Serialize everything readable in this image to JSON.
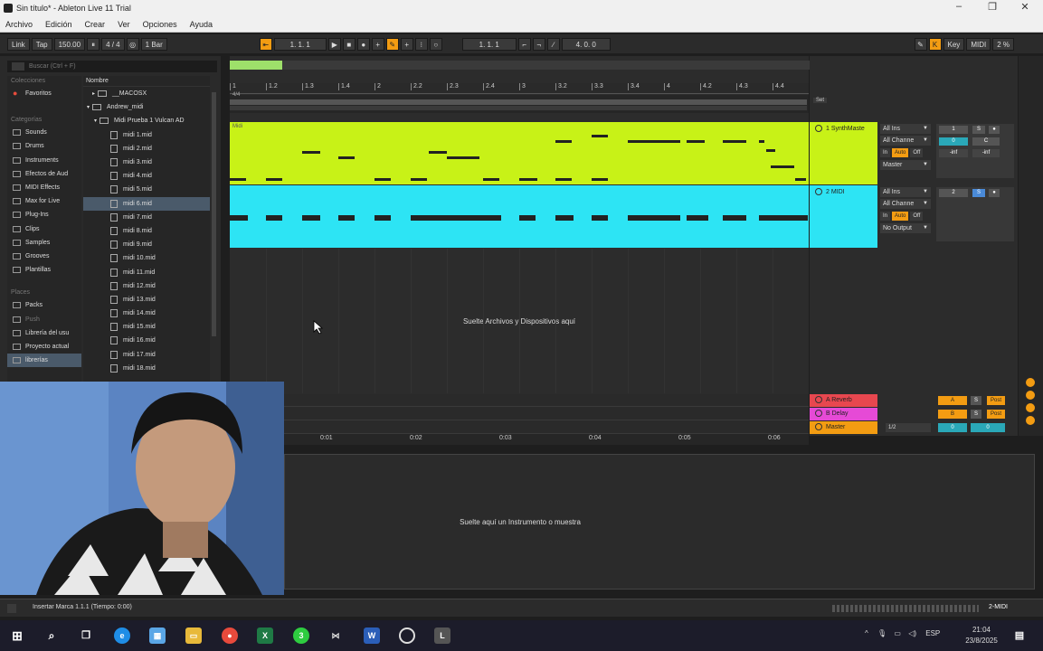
{
  "window": {
    "title": "Sin título* - Ableton Live 11 Trial",
    "minimize": "–",
    "maximize": "❐",
    "close": "✕"
  },
  "menu": [
    "Archivo",
    "Edición",
    "Crear",
    "Ver",
    "Opciones",
    "Ayuda"
  ],
  "control_bar": {
    "link": "Link",
    "tap": "Tap",
    "tempo": "150.00",
    "signature": "4 / 4",
    "quantize": "1 Bar",
    "position": "1.  1.  1",
    "loop_start": "1.  1.  1",
    "loop_length": "4.  0.  0",
    "key": "Key",
    "midi": "MIDI",
    "cpu": "2 %"
  },
  "browser": {
    "search_placeholder": "Buscar (Ctrl + F)",
    "collections_header": "Colecciones",
    "favorites": "Favoritos",
    "categories_header": "Categorías",
    "categories": [
      "Sounds",
      "Drums",
      "Instruments",
      "Efectos de Aud",
      "MIDI Effects",
      "Max for Live",
      "Plug-Ins",
      "Clips",
      "Samples",
      "Grooves",
      "Plantillas"
    ],
    "places_header": "Places",
    "places": [
      "Packs",
      "Push",
      "Librería del usu",
      "Proyecto actual",
      "librerías"
    ],
    "name_header": "Nombre",
    "folders": [
      "__MACOSX",
      "Andrew_midi",
      "Midi Prueba 1 Vulcan AD"
    ],
    "files": [
      "midi 1.mid",
      "midi 2.mid",
      "midi 3.mid",
      "midi 4.mid",
      "midi 5.mid",
      "midi 6.mid",
      "midi 7.mid",
      "midi 8.mid",
      "midi 9.mid",
      "midi 10.mid",
      "midi 11.mid",
      "midi 12.mid",
      "midi 13.mid",
      "midi 14.mid",
      "midi 15.mid",
      "midi 16.mid",
      "midi 17.mid",
      "midi 18.mid"
    ],
    "selected_file": "midi 6.mid"
  },
  "arrangement": {
    "time_signature": "4/4",
    "ruler": [
      "1",
      "1.2",
      "1.3",
      "1.4",
      "2",
      "2.2",
      "2.3",
      "2.4",
      "3",
      "3.2",
      "3.3",
      "3.4",
      "4",
      "4.2",
      "4.3",
      "4.4"
    ],
    "drop_files_text": "Suelte Archivos y Dispositivos aquí",
    "clip1_name": "Midi",
    "set_label": "Set",
    "time_ruler": [
      "0:01",
      "0:02",
      "0:03",
      "0:04",
      "0:05",
      "0:06"
    ]
  },
  "tracks": [
    {
      "name": "1 SynthMaste",
      "color": "#c8f217",
      "input": "All Ins",
      "channel": "All Channe",
      "monitor": [
        "In",
        "Auto",
        "Off"
      ],
      "output": "Master",
      "volume": "-inf",
      "pan": "-inf",
      "number": "1",
      "solo": "S",
      "center": "C",
      "zero": "0"
    },
    {
      "name": "2 MIDI",
      "color": "#2de4f4",
      "input": "All Ins",
      "channel": "All Channe",
      "monitor": [
        "In",
        "Auto",
        "Off"
      ],
      "output": "No Output",
      "number": "2",
      "solo": "S"
    }
  ],
  "returns": [
    {
      "name": "A Reverb",
      "color": "#e8474f",
      "letter": "A",
      "solo": "S",
      "post": "Post"
    },
    {
      "name": "B Delay",
      "color": "#e64ad6",
      "letter": "B",
      "solo": "S",
      "post": "Post"
    },
    {
      "name": "Master",
      "color": "#f39c12",
      "cue": "1/2",
      "vol": "0",
      "pan": "0"
    }
  ],
  "detail": {
    "drop_instrument_text": "Suelte aquí un Instrumento o muestra"
  },
  "status": {
    "text": "Insertar Marca 1.1.1 (Tiempo: 0:00)",
    "track_name": "2-MIDI"
  },
  "taskbar": {
    "lang": "ESP",
    "time": "21:04",
    "date": "23/8/2025",
    "whatsapp_badge": "3"
  },
  "colors": {
    "clip_green": "#c8f217",
    "clip_cyan": "#2de4f4",
    "accent_orange": "#f39c12"
  }
}
